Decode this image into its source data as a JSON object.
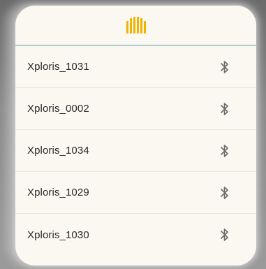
{
  "app": {
    "logo_icon": "brand-bars-icon",
    "accent_color": "#f0b400",
    "divider_color": "#a9cfd0"
  },
  "devices": [
    {
      "name": "Xploris_1031",
      "icon": "bluetooth-icon"
    },
    {
      "name": "Xploris_0002",
      "icon": "bluetooth-icon"
    },
    {
      "name": "Xploris_1034",
      "icon": "bluetooth-icon"
    },
    {
      "name": "Xploris_1029",
      "icon": "bluetooth-icon"
    },
    {
      "name": "Xploris_1030",
      "icon": "bluetooth-icon"
    }
  ]
}
